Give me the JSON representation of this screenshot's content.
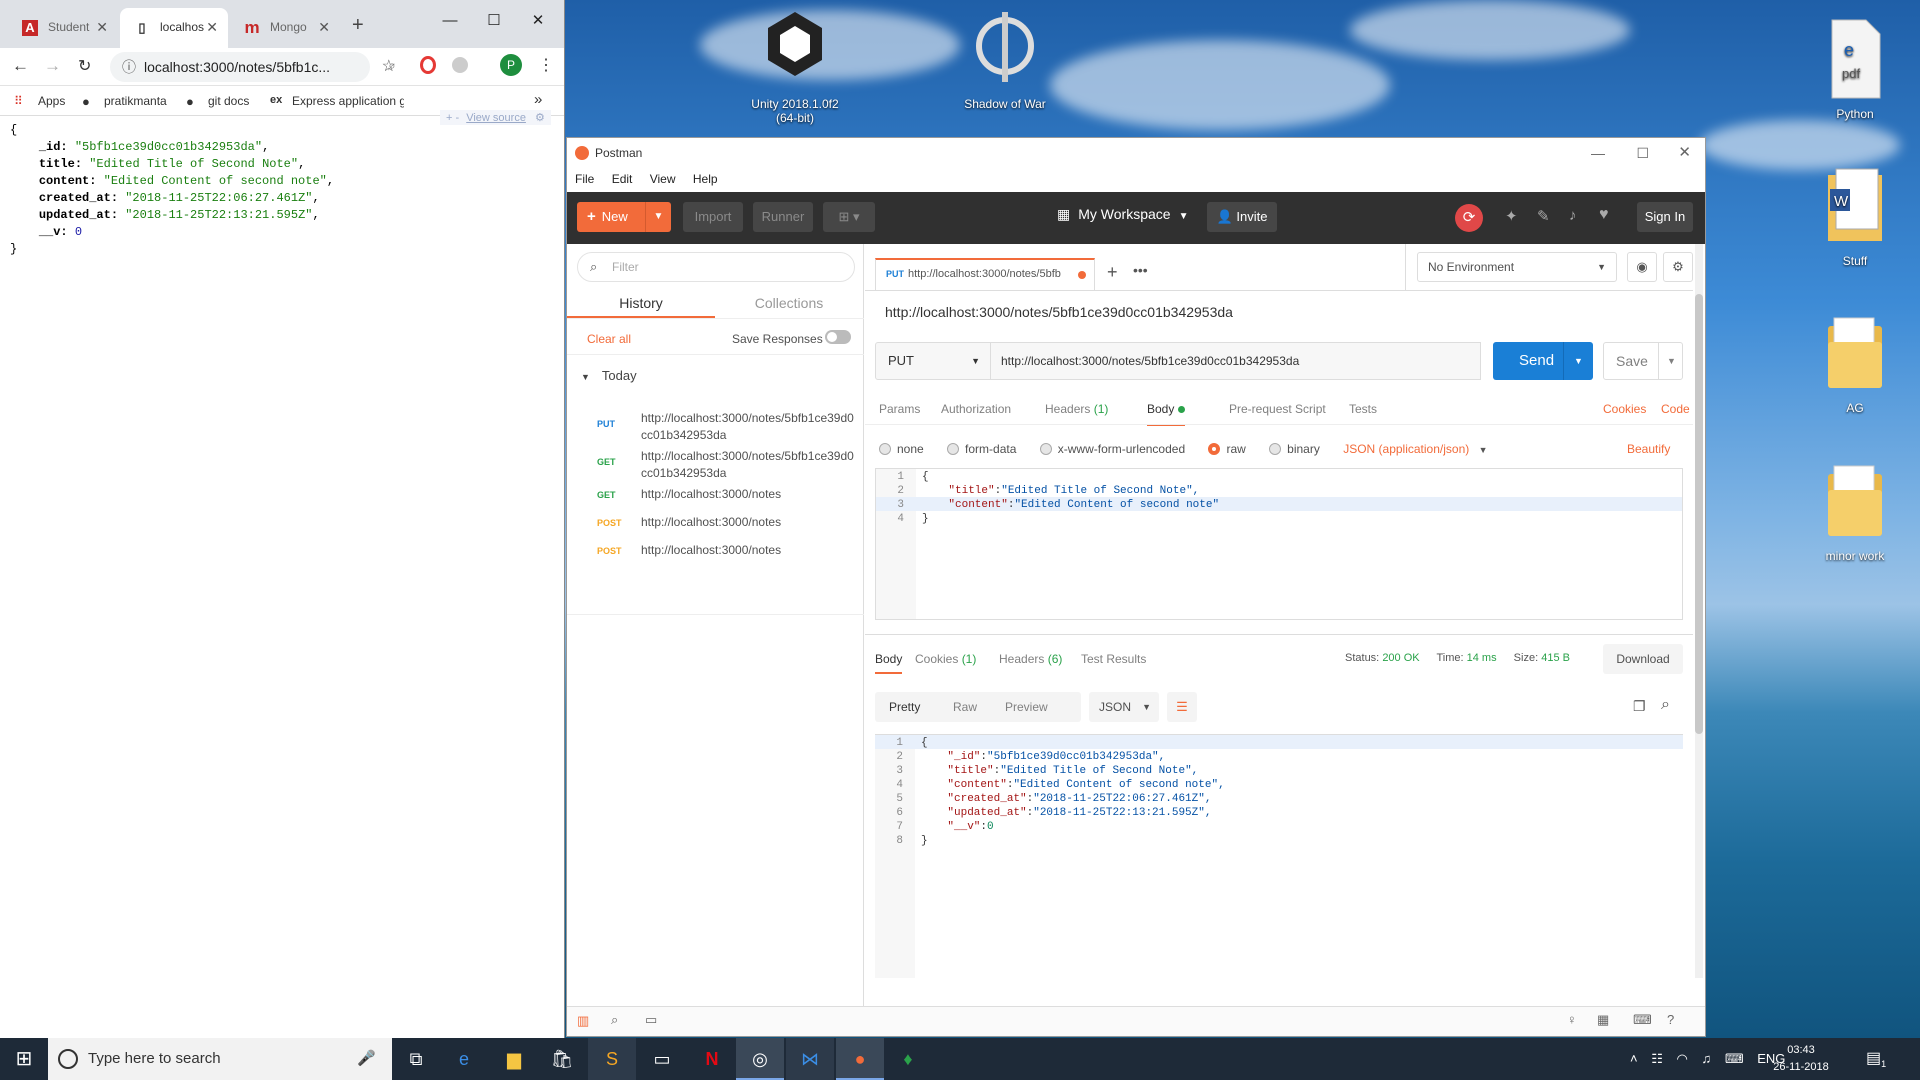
{
  "desktop": {
    "icons": [
      {
        "label": "Unity 2018.1.0f2 (64-bit)"
      },
      {
        "label": "Shadow of War"
      },
      {
        "label": "Python"
      },
      {
        "label": "Stuff"
      },
      {
        "label": "AG"
      },
      {
        "label": "minor work"
      }
    ]
  },
  "chrome": {
    "tabs": [
      {
        "title": "Student",
        "favicon": "A"
      },
      {
        "title": "localhos",
        "favicon": "document-icon"
      },
      {
        "title": "Mongo",
        "favicon": "m"
      }
    ],
    "new_tab": "+",
    "address": "localhost:3000/notes/5bfb1c...",
    "profile_initial": "P",
    "bookmarks": [
      "Apps",
      "pratikmanta",
      "git docs",
      "Express application g"
    ],
    "bookmarks_more": "»",
    "view_source": "View source",
    "view_source_prefix": "+ -",
    "json_lines": [
      {
        "key": "_id",
        "value": "\"5bfb1ce39d0cc01b342953da\"",
        "type": "s"
      },
      {
        "key": "title",
        "value": "\"Edited Title of Second Note\"",
        "type": "s"
      },
      {
        "key": "content",
        "value": "\"Edited Content of second note\"",
        "type": "s"
      },
      {
        "key": "created_at",
        "value": "\"2018-11-25T22:06:27.461Z\"",
        "type": "s"
      },
      {
        "key": "updated_at",
        "value": "\"2018-11-25T22:13:21.595Z\"",
        "type": "s"
      },
      {
        "key": "__v",
        "value": "0",
        "type": "n"
      }
    ]
  },
  "postman": {
    "title": "Postman",
    "menu": [
      "File",
      "Edit",
      "View",
      "Help"
    ],
    "header": {
      "new": "New",
      "import": "Import",
      "runner": "Runner",
      "workspace": "My Workspace",
      "invite": "Invite",
      "sign_in": "Sign In"
    },
    "sidebar": {
      "filter_placeholder": "Filter",
      "tab_history": "History",
      "tab_collections": "Collections",
      "clear_all": "Clear all",
      "save_responses": "Save Responses",
      "group": "Today",
      "items": [
        {
          "method": "PUT",
          "url": "http://localhost:3000/notes/5bfb1ce39d0cc01b342953da",
          "color": "#1c7fd6"
        },
        {
          "method": "GET",
          "url": "http://localhost:3000/notes/5bfb1ce39d0cc01b342953da",
          "color": "#2aa24a"
        },
        {
          "method": "GET",
          "url": "http://localhost:3000/notes",
          "color": "#2aa24a"
        },
        {
          "method": "POST",
          "url": "http://localhost:3000/notes",
          "color": "#f5a623"
        },
        {
          "method": "POST",
          "url": "http://localhost:3000/notes",
          "color": "#f5a623"
        }
      ]
    },
    "request": {
      "tab_method": "PUT",
      "tab_url": "http://localhost:3000/notes/5bfb",
      "environment": "No Environment",
      "title_url": "http://localhost:3000/notes/5bfb1ce39d0cc01b342953da",
      "method": "PUT",
      "url": "http://localhost:3000/notes/5bfb1ce39d0cc01b342953da",
      "send": "Send",
      "save": "Save",
      "tabs": [
        "Params",
        "Authorization",
        "Headers",
        "Body",
        "Pre-request Script",
        "Tests"
      ],
      "headers_count": "(1)",
      "cookies": "Cookies",
      "code": "Code",
      "body_modes": [
        "none",
        "form-data",
        "x-www-form-urlencoded",
        "raw",
        "binary"
      ],
      "content_type": "JSON (application/json)",
      "beautify": "Beautify",
      "body_lines": [
        {
          "n": "1",
          "text": "{"
        },
        {
          "n": "2",
          "key": "\"title\"",
          "val": "\"Edited Title of Second Note\","
        },
        {
          "n": "3",
          "key": "\"content\"",
          "val": "\"Edited Content of second note\""
        },
        {
          "n": "4",
          "text": "}"
        }
      ]
    },
    "response": {
      "tabs": [
        "Body",
        "Cookies (1)",
        "Headers (6)",
        "Test Results"
      ],
      "status_label": "Status:",
      "status": "200 OK",
      "time_label": "Time:",
      "time": "14 ms",
      "size_label": "Size:",
      "size": "415 B",
      "download": "Download",
      "views": [
        "Pretty",
        "Raw",
        "Preview"
      ],
      "format": "JSON",
      "lines": [
        {
          "n": "1",
          "text": "{"
        },
        {
          "n": "2",
          "key": "\"_id\"",
          "val": "\"5bfb1ce39d0cc01b342953da\",",
          "t": "str"
        },
        {
          "n": "3",
          "key": "\"title\"",
          "val": "\"Edited Title of Second Note\",",
          "t": "str"
        },
        {
          "n": "4",
          "key": "\"content\"",
          "val": "\"Edited Content of second note\",",
          "t": "str"
        },
        {
          "n": "5",
          "key": "\"created_at\"",
          "val": "\"2018-11-25T22:06:27.461Z\",",
          "t": "str"
        },
        {
          "n": "6",
          "key": "\"updated_at\"",
          "val": "\"2018-11-25T22:13:21.595Z\",",
          "t": "str"
        },
        {
          "n": "7",
          "key": "\"__v\"",
          "val": "0",
          "t": "num"
        },
        {
          "n": "8",
          "text": "}"
        }
      ]
    }
  },
  "taskbar": {
    "search_placeholder": "Type here to search",
    "lang": "ENG",
    "time": "03:43",
    "date": "26-11-2018",
    "notif_count": "1"
  },
  "colors": {
    "accent_orange": "#f26b3a",
    "send_blue": "#1a7fd6"
  }
}
